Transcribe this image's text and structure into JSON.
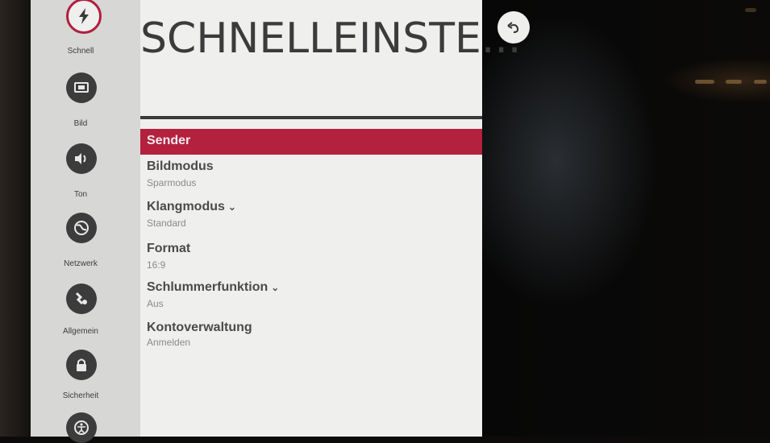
{
  "panel": {
    "title": "SCHNELLEINSTE...",
    "items": [
      {
        "label": "Sender",
        "value": ""
      },
      {
        "label": "Bildmodus",
        "value": "Sparmodus"
      },
      {
        "label": "Klangmodus",
        "value": "Standard"
      },
      {
        "label": "Format",
        "value": "16:9"
      },
      {
        "label": "Schlummerfunktion",
        "value": "Aus"
      },
      {
        "label": "Kontoverwaltung",
        "value": "Anmelden"
      }
    ]
  },
  "sidebar": {
    "items": [
      {
        "label": "Schnell",
        "icon": "lightning-icon"
      },
      {
        "label": "Bild",
        "icon": "picture-icon"
      },
      {
        "label": "Ton",
        "icon": "speaker-icon"
      },
      {
        "label": "Netzwerk",
        "icon": "globe-icon"
      },
      {
        "label": "Allgemein",
        "icon": "tools-icon"
      },
      {
        "label": "Sicherheit",
        "icon": "lock-icon"
      },
      {
        "label": "",
        "icon": "accessibility-icon"
      }
    ]
  },
  "colors": {
    "accent": "#b3213f",
    "panel_bg": "#efefee",
    "sidebar_bg": "#d7d7d5"
  },
  "back_button": {
    "icon": "back-arrow-icon"
  }
}
